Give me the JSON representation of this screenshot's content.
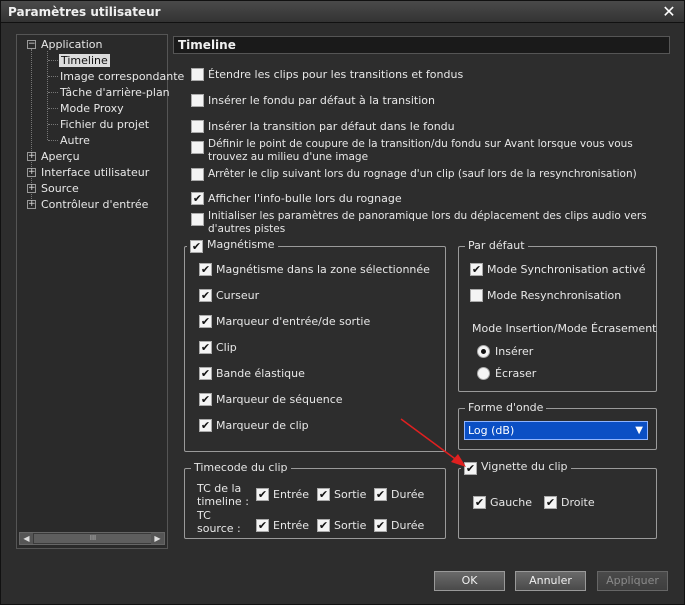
{
  "window": {
    "title": "Paramètres utilisateur"
  },
  "tree": {
    "application": "Application",
    "app_children": [
      "Timeline",
      "Image correspondante",
      "Tâche d'arrière-plan",
      "Mode Proxy",
      "Fichier du projet",
      "Autre"
    ],
    "apercu": "Aperçu",
    "interface": "Interface utilisateur",
    "source": "Source",
    "controleur": "Contrôleur d'entrée",
    "scroll_thumb": "III"
  },
  "section": {
    "title": "Timeline"
  },
  "options": [
    {
      "label": "Étendre les clips pour les transitions et fondus",
      "checked": false
    },
    {
      "label": "Insérer le fondu par défaut à la transition",
      "checked": false
    },
    {
      "label": "Insérer la transition par défaut dans le fondu",
      "checked": false
    },
    {
      "label": "Définir le point de coupure de la transition/du fondu sur Avant lorsque vous vous trouvez au milieu d'une image",
      "checked": false
    },
    {
      "label": "Arrêter le clip suivant lors du rognage d'un clip (sauf lors de la resynchronisation)",
      "checked": false
    },
    {
      "label": "Afficher l'info-bulle lors du rognage",
      "checked": true
    },
    {
      "label": "Initialiser les paramètres de panoramique lors du déplacement des clips audio vers d'autres pistes",
      "checked": false
    }
  ],
  "magnetisme": {
    "title": "Magnétisme",
    "checked": true,
    "items": [
      {
        "label": "Magnétisme dans la zone sélectionnée",
        "checked": true
      },
      {
        "label": "Curseur",
        "checked": true
      },
      {
        "label": "Marqueur d'entrée/de sortie",
        "checked": true
      },
      {
        "label": "Clip",
        "checked": true
      },
      {
        "label": "Bande élastique",
        "checked": true
      },
      {
        "label": "Marqueur de séquence",
        "checked": true
      },
      {
        "label": "Marqueur de clip",
        "checked": true
      }
    ]
  },
  "par_defaut": {
    "title": "Par défaut",
    "sync": {
      "label": "Mode Synchronisation activé",
      "checked": true
    },
    "resync": {
      "label": "Mode Resynchronisation",
      "checked": false
    },
    "mode_label": "Mode Insertion/Mode Écrasement",
    "inserer": "Insérer",
    "ecraser": "Écraser",
    "selected": "Insérer"
  },
  "forme_onde": {
    "title": "Forme d'onde",
    "value": "Log (dB)"
  },
  "timecode": {
    "title": "Timecode du clip",
    "tc_timeline": "TC de la timeline :",
    "tc_source": "TC source :",
    "entree": "Entrée",
    "sortie": "Sortie",
    "duree": "Durée"
  },
  "vignette": {
    "title": "Vignette du clip",
    "checked": true,
    "gauche": "Gauche",
    "droite": "Droite"
  },
  "buttons": {
    "ok": "OK",
    "annuler": "Annuler",
    "appliquer": "Appliquer"
  },
  "colors": {
    "accent": "#0b4fc4",
    "annotation_arrow": "#e02020"
  }
}
